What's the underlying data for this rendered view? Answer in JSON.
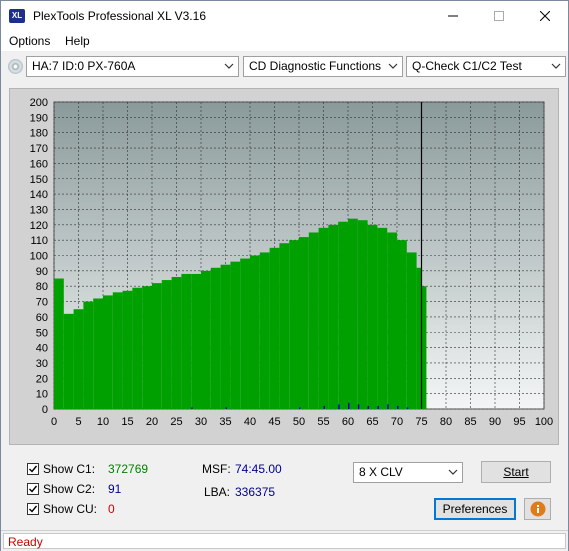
{
  "window": {
    "title": "PlexTools Professional XL V3.16",
    "icon_text": "XL"
  },
  "menu": {
    "options": "Options",
    "help": "Help"
  },
  "toolbar": {
    "drive": "HA:7 ID:0  PX-760A",
    "function": "CD Diagnostic Functions",
    "test": "Q-Check C1/C2 Test"
  },
  "chart_data": {
    "type": "bar",
    "x_ticks": [
      "0",
      "5",
      "10",
      "15",
      "20",
      "25",
      "30",
      "35",
      "40",
      "45",
      "50",
      "55",
      "60",
      "65",
      "70",
      "75",
      "80",
      "85",
      "90",
      "95",
      "100"
    ],
    "y_ticks": [
      "200",
      "190",
      "180",
      "170",
      "160",
      "150",
      "140",
      "130",
      "120",
      "110",
      "100",
      "90",
      "80",
      "70",
      "60",
      "50",
      "40",
      "30",
      "20",
      "10",
      "0"
    ],
    "xlim": [
      0,
      100
    ],
    "ylim": [
      0,
      200
    ],
    "grid": true,
    "cursor_x": 75,
    "series": [
      {
        "color": "#00a000",
        "x": [
          0,
          2,
          4,
          6,
          8,
          10,
          12,
          14,
          16,
          18,
          20,
          22,
          24,
          26,
          28,
          30,
          32,
          34,
          36,
          38,
          40,
          42,
          44,
          46,
          48,
          50,
          52,
          54,
          56,
          58,
          60,
          62,
          64,
          66,
          68,
          70,
          72,
          74,
          75
        ],
        "values": [
          85,
          62,
          65,
          70,
          72,
          74,
          76,
          77,
          79,
          80,
          82,
          84,
          86,
          88,
          88,
          90,
          92,
          94,
          96,
          98,
          100,
          102,
          105,
          108,
          110,
          112,
          115,
          118,
          120,
          122,
          124,
          123,
          120,
          118,
          115,
          110,
          102,
          92,
          80
        ]
      },
      {
        "color": "#0000c0",
        "x": [
          28,
          35,
          50,
          55,
          58,
          60,
          62,
          64,
          66,
          68,
          70,
          72
        ],
        "values": [
          1,
          1,
          1,
          2,
          3,
          4,
          3,
          2,
          2,
          3,
          2,
          1
        ]
      }
    ]
  },
  "stats": {
    "c1_label": "Show C1:",
    "c1_value": "372769",
    "c2_label": "Show C2:",
    "c2_value": "91",
    "cu_label": "Show CU:",
    "cu_value": "0",
    "msf_label": "MSF:",
    "msf_value": "74:45.00",
    "lba_label": "LBA:",
    "lba_value": "336375",
    "c1_color": "#008000",
    "c2_color": "#00008b",
    "cu_color": "#cc0000"
  },
  "controls": {
    "speed": "8 X CLV",
    "start": "Start",
    "preferences": "Preferences"
  },
  "status": {
    "text": "Ready",
    "color": "#cc0000"
  }
}
